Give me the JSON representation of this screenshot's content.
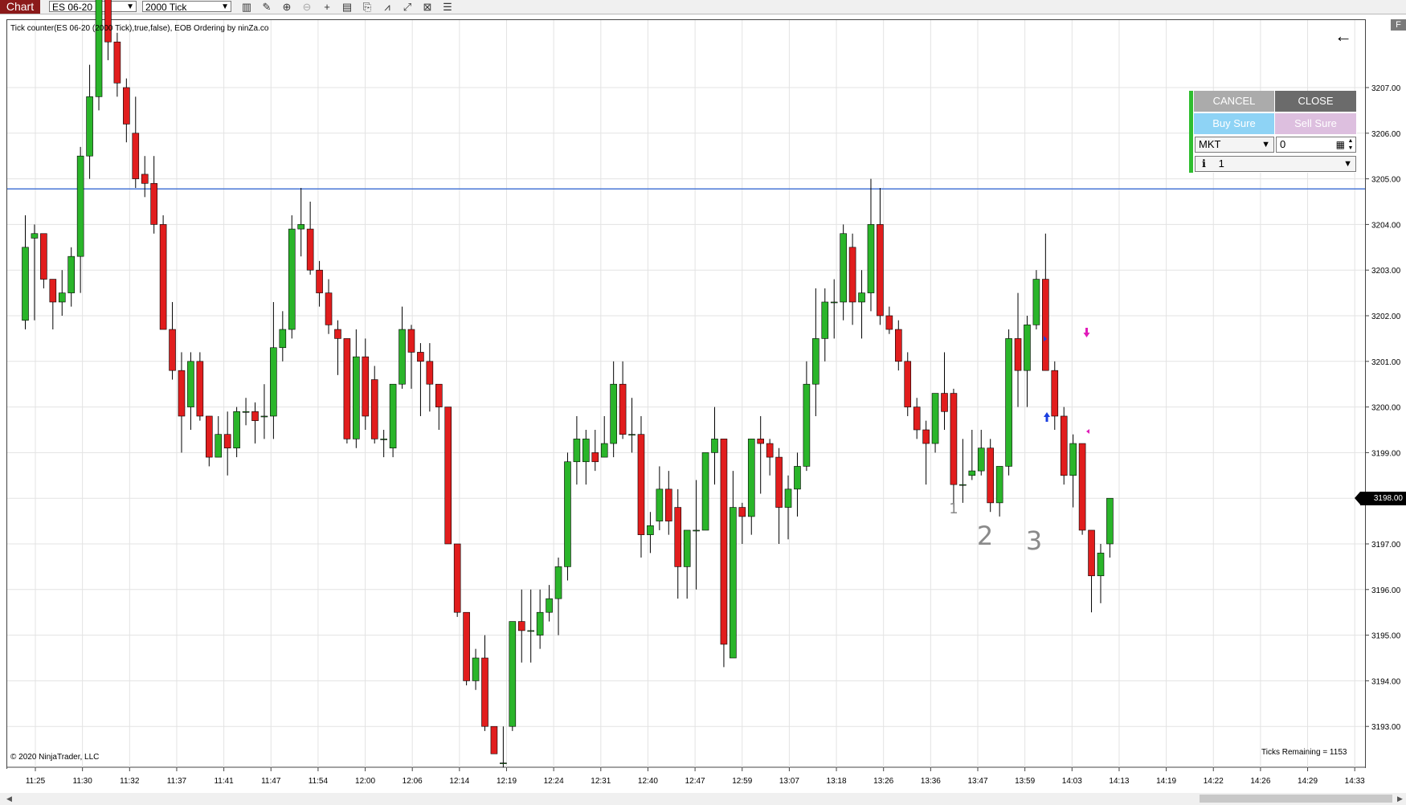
{
  "toolbar": {
    "chart_tab": "Chart",
    "instrument": "ES 06-20",
    "interval": "2000 Tick",
    "icons": [
      "bar-type-icon",
      "draw-pencil-icon",
      "zoom-in-icon",
      "zoom-out-icon",
      "crosshair-icon",
      "properties-icon",
      "strategy-icon",
      "indicator-icon",
      "chart-trader-icon",
      "data-box-icon"
    ]
  },
  "chart": {
    "indicator_label": "Tick counter(ES 06-20 (2000 Tick),true,false), EOB Ordering by ninZa.co",
    "copyright": "© 2020 NinjaTrader, LLC",
    "ticks_remaining": "Ticks Remaining = 1153",
    "last_price": "3198.00",
    "price_levels": [
      "3207.00",
      "3206.00",
      "3205.00",
      "3204.00",
      "3203.00",
      "3202.00",
      "3201.00",
      "3200.00",
      "3199.00",
      "3198.00",
      "3197.00",
      "3196.00",
      "3195.00",
      "3194.00",
      "3193.00"
    ],
    "time_labels": [
      "11:25",
      "11:30",
      "11:32",
      "11:37",
      "11:41",
      "11:47",
      "11:54",
      "12:00",
      "12:06",
      "12:14",
      "12:19",
      "12:24",
      "12:31",
      "12:40",
      "12:47",
      "12:59",
      "13:07",
      "13:18",
      "13:26",
      "13:36",
      "13:47",
      "13:59",
      "14:03",
      "14:13",
      "14:19",
      "14:22",
      "14:26",
      "14:29",
      "14:33"
    ],
    "horizontal_line_price": 3204.78,
    "handwritten_annotations": [
      "1",
      "2",
      "3"
    ],
    "colors": {
      "up": "#2ab52a",
      "down": "#e11d1d",
      "line": "#4a78d6",
      "grid": "#e3e3e3"
    }
  },
  "chart_data": {
    "type": "candlestick",
    "y_axis_range": [
      3192.1,
      3208.9
    ],
    "bars": [
      {
        "o": 3201.9,
        "h": 3204.2,
        "l": 3201.7,
        "c": 3203.5
      },
      {
        "o": 3203.7,
        "h": 3204.0,
        "l": 3201.9,
        "c": 3203.8
      },
      {
        "o": 3203.8,
        "h": 3203.8,
        "l": 3202.6,
        "c": 3202.8
      },
      {
        "o": 3202.8,
        "h": 3202.8,
        "l": 3201.7,
        "c": 3202.3
      },
      {
        "o": 3202.3,
        "h": 3203.0,
        "l": 3202.0,
        "c": 3202.5
      },
      {
        "o": 3202.5,
        "h": 3203.5,
        "l": 3202.2,
        "c": 3203.3
      },
      {
        "o": 3203.3,
        "h": 3205.7,
        "l": 3202.5,
        "c": 3205.5
      },
      {
        "o": 3205.5,
        "h": 3207.5,
        "l": 3205.0,
        "c": 3206.8
      },
      {
        "o": 3206.8,
        "h": 3209.0,
        "l": 3206.5,
        "c": 3209.0
      },
      {
        "o": 3209.0,
        "h": 3209.0,
        "l": 3207.6,
        "c": 3208.0
      },
      {
        "o": 3208.0,
        "h": 3208.2,
        "l": 3206.8,
        "c": 3207.1
      },
      {
        "o": 3207.0,
        "h": 3207.2,
        "l": 3205.8,
        "c": 3206.2
      },
      {
        "o": 3206.0,
        "h": 3206.8,
        "l": 3204.8,
        "c": 3205.0
      },
      {
        "o": 3205.1,
        "h": 3205.5,
        "l": 3204.6,
        "c": 3204.9
      },
      {
        "o": 3204.9,
        "h": 3205.5,
        "l": 3203.8,
        "c": 3204.0
      },
      {
        "o": 3204.0,
        "h": 3204.2,
        "l": 3201.7,
        "c": 3201.7
      },
      {
        "o": 3201.7,
        "h": 3202.3,
        "l": 3200.6,
        "c": 3200.8
      },
      {
        "o": 3200.8,
        "h": 3201.2,
        "l": 3199.0,
        "c": 3199.8
      },
      {
        "o": 3200.0,
        "h": 3201.2,
        "l": 3199.5,
        "c": 3201.0
      },
      {
        "o": 3201.0,
        "h": 3201.2,
        "l": 3199.7,
        "c": 3199.8
      },
      {
        "o": 3199.8,
        "h": 3199.8,
        "l": 3198.7,
        "c": 3198.9
      },
      {
        "o": 3198.9,
        "h": 3199.8,
        "l": 3198.9,
        "c": 3199.4
      },
      {
        "o": 3199.4,
        "h": 3199.9,
        "l": 3198.5,
        "c": 3199.1
      },
      {
        "o": 3199.1,
        "h": 3200.0,
        "l": 3198.9,
        "c": 3199.9
      },
      {
        "o": 3199.9,
        "h": 3200.2,
        "l": 3199.6,
        "c": 3199.9
      },
      {
        "o": 3199.9,
        "h": 3200.1,
        "l": 3199.2,
        "c": 3199.7
      },
      {
        "o": 3199.8,
        "h": 3200.5,
        "l": 3199.3,
        "c": 3199.8
      },
      {
        "o": 3199.8,
        "h": 3202.3,
        "l": 3199.3,
        "c": 3201.3
      },
      {
        "o": 3201.3,
        "h": 3202.1,
        "l": 3201.0,
        "c": 3201.7
      },
      {
        "o": 3201.7,
        "h": 3204.2,
        "l": 3201.5,
        "c": 3203.9
      },
      {
        "o": 3203.9,
        "h": 3204.8,
        "l": 3203.3,
        "c": 3204.0
      },
      {
        "o": 3203.9,
        "h": 3204.5,
        "l": 3202.9,
        "c": 3203.0
      },
      {
        "o": 3203.0,
        "h": 3203.2,
        "l": 3202.2,
        "c": 3202.5
      },
      {
        "o": 3202.5,
        "h": 3202.8,
        "l": 3201.6,
        "c": 3201.8
      },
      {
        "o": 3201.7,
        "h": 3201.9,
        "l": 3200.7,
        "c": 3201.5
      },
      {
        "o": 3201.5,
        "h": 3201.5,
        "l": 3199.2,
        "c": 3199.3
      },
      {
        "o": 3199.3,
        "h": 3201.7,
        "l": 3199.1,
        "c": 3201.1
      },
      {
        "o": 3201.1,
        "h": 3201.5,
        "l": 3199.5,
        "c": 3199.8
      },
      {
        "o": 3200.6,
        "h": 3200.9,
        "l": 3199.2,
        "c": 3199.3
      },
      {
        "o": 3199.3,
        "h": 3199.5,
        "l": 3198.9,
        "c": 3199.3
      },
      {
        "o": 3199.1,
        "h": 3200.5,
        "l": 3198.9,
        "c": 3200.5
      },
      {
        "o": 3200.5,
        "h": 3202.2,
        "l": 3200.4,
        "c": 3201.7
      },
      {
        "o": 3201.7,
        "h": 3201.8,
        "l": 3200.4,
        "c": 3201.2
      },
      {
        "o": 3201.2,
        "h": 3201.4,
        "l": 3199.8,
        "c": 3201.0
      },
      {
        "o": 3201.0,
        "h": 3201.4,
        "l": 3199.9,
        "c": 3200.5
      },
      {
        "o": 3200.5,
        "h": 3200.5,
        "l": 3199.5,
        "c": 3200.0
      },
      {
        "o": 3200.0,
        "h": 3200.0,
        "l": 3197.0,
        "c": 3197.0
      },
      {
        "o": 3197.0,
        "h": 3197.0,
        "l": 3195.4,
        "c": 3195.5
      },
      {
        "o": 3195.5,
        "h": 3195.5,
        "l": 3193.9,
        "c": 3194.0
      },
      {
        "o": 3194.0,
        "h": 3194.7,
        "l": 3193.8,
        "c": 3194.5
      },
      {
        "o": 3194.5,
        "h": 3195.0,
        "l": 3192.9,
        "c": 3193.0
      },
      {
        "o": 3193.0,
        "h": 3193.0,
        "l": 3192.4,
        "c": 3192.4
      },
      {
        "o": 3192.2,
        "h": 3193.0,
        "l": 3192.1,
        "c": 3192.2
      },
      {
        "o": 3193.0,
        "h": 3195.2,
        "l": 3192.9,
        "c": 3195.3
      },
      {
        "o": 3195.3,
        "h": 3196.0,
        "l": 3194.4,
        "c": 3195.1
      },
      {
        "o": 3195.1,
        "h": 3196.0,
        "l": 3194.4,
        "c": 3195.1
      },
      {
        "o": 3195.0,
        "h": 3196.0,
        "l": 3194.7,
        "c": 3195.5
      },
      {
        "o": 3195.5,
        "h": 3196.1,
        "l": 3195.3,
        "c": 3195.8
      },
      {
        "o": 3195.8,
        "h": 3196.7,
        "l": 3195.0,
        "c": 3196.5
      },
      {
        "o": 3196.5,
        "h": 3199.0,
        "l": 3196.2,
        "c": 3198.8
      },
      {
        "o": 3198.8,
        "h": 3199.8,
        "l": 3198.3,
        "c": 3199.3
      },
      {
        "o": 3198.8,
        "h": 3199.5,
        "l": 3198.3,
        "c": 3199.3
      },
      {
        "o": 3199.0,
        "h": 3199.5,
        "l": 3198.6,
        "c": 3198.8
      },
      {
        "o": 3198.9,
        "h": 3199.8,
        "l": 3198.9,
        "c": 3199.2
      },
      {
        "o": 3199.2,
        "h": 3201.0,
        "l": 3198.9,
        "c": 3200.5
      },
      {
        "o": 3200.5,
        "h": 3201.0,
        "l": 3199.3,
        "c": 3199.4
      },
      {
        "o": 3199.4,
        "h": 3200.2,
        "l": 3199.0,
        "c": 3199.4
      },
      {
        "o": 3199.4,
        "h": 3199.8,
        "l": 3196.7,
        "c": 3197.2
      },
      {
        "o": 3197.2,
        "h": 3197.7,
        "l": 3196.8,
        "c": 3197.4
      },
      {
        "o": 3197.5,
        "h": 3198.7,
        "l": 3197.3,
        "c": 3198.2
      },
      {
        "o": 3198.2,
        "h": 3198.6,
        "l": 3197.2,
        "c": 3197.5
      },
      {
        "o": 3197.8,
        "h": 3198.2,
        "l": 3195.8,
        "c": 3196.5
      },
      {
        "o": 3196.5,
        "h": 3197.3,
        "l": 3195.8,
        "c": 3197.3
      },
      {
        "o": 3197.3,
        "h": 3198.4,
        "l": 3196.0,
        "c": 3197.3
      },
      {
        "o": 3197.3,
        "h": 3199.0,
        "l": 3197.3,
        "c": 3199.0
      },
      {
        "o": 3199.0,
        "h": 3200.0,
        "l": 3198.3,
        "c": 3199.3
      },
      {
        "o": 3199.3,
        "h": 3199.3,
        "l": 3194.3,
        "c": 3194.8
      },
      {
        "o": 3194.5,
        "h": 3198.6,
        "l": 3194.5,
        "c": 3197.8
      },
      {
        "o": 3197.8,
        "h": 3197.9,
        "l": 3197.0,
        "c": 3197.6
      },
      {
        "o": 3197.6,
        "h": 3199.3,
        "l": 3197.2,
        "c": 3199.3
      },
      {
        "o": 3199.3,
        "h": 3199.8,
        "l": 3198.1,
        "c": 3199.2
      },
      {
        "o": 3199.2,
        "h": 3199.3,
        "l": 3198.5,
        "c": 3198.9
      },
      {
        "o": 3198.9,
        "h": 3199.1,
        "l": 3197.0,
        "c": 3197.8
      },
      {
        "o": 3197.8,
        "h": 3198.5,
        "l": 3197.1,
        "c": 3198.2
      },
      {
        "o": 3198.2,
        "h": 3199.0,
        "l": 3197.6,
        "c": 3198.7
      },
      {
        "o": 3198.7,
        "h": 3201.0,
        "l": 3198.6,
        "c": 3200.5
      },
      {
        "o": 3200.5,
        "h": 3202.6,
        "l": 3199.8,
        "c": 3201.5
      },
      {
        "o": 3201.5,
        "h": 3202.6,
        "l": 3201.0,
        "c": 3202.3
      },
      {
        "o": 3202.3,
        "h": 3202.8,
        "l": 3201.5,
        "c": 3202.3
      },
      {
        "o": 3202.3,
        "h": 3204.0,
        "l": 3201.9,
        "c": 3203.8
      },
      {
        "o": 3203.5,
        "h": 3203.8,
        "l": 3201.8,
        "c": 3202.3
      },
      {
        "o": 3202.3,
        "h": 3203.0,
        "l": 3201.5,
        "c": 3202.5
      },
      {
        "o": 3202.5,
        "h": 3205.0,
        "l": 3202.1,
        "c": 3204.0
      },
      {
        "o": 3204.0,
        "h": 3204.8,
        "l": 3201.8,
        "c": 3202.0
      },
      {
        "o": 3202.0,
        "h": 3202.2,
        "l": 3201.6,
        "c": 3201.7
      },
      {
        "o": 3201.7,
        "h": 3201.9,
        "l": 3200.8,
        "c": 3201.0
      },
      {
        "o": 3201.0,
        "h": 3201.2,
        "l": 3199.8,
        "c": 3200.0
      },
      {
        "o": 3200.0,
        "h": 3200.2,
        "l": 3199.3,
        "c": 3199.5
      },
      {
        "o": 3199.5,
        "h": 3199.7,
        "l": 3198.3,
        "c": 3199.2
      },
      {
        "o": 3199.2,
        "h": 3200.2,
        "l": 3199.0,
        "c": 3200.3
      },
      {
        "o": 3200.3,
        "h": 3201.2,
        "l": 3199.5,
        "c": 3199.9
      },
      {
        "o": 3200.3,
        "h": 3200.4,
        "l": 3197.8,
        "c": 3198.3
      },
      {
        "o": 3198.3,
        "h": 3199.3,
        "l": 3197.9,
        "c": 3198.3
      },
      {
        "o": 3198.5,
        "h": 3199.5,
        "l": 3198.4,
        "c": 3198.6
      },
      {
        "o": 3198.6,
        "h": 3199.5,
        "l": 3198.5,
        "c": 3199.1
      },
      {
        "o": 3199.1,
        "h": 3199.3,
        "l": 3197.7,
        "c": 3197.9
      },
      {
        "o": 3197.9,
        "h": 3198.7,
        "l": 3197.6,
        "c": 3198.7
      },
      {
        "o": 3198.7,
        "h": 3201.7,
        "l": 3198.5,
        "c": 3201.5
      },
      {
        "o": 3201.5,
        "h": 3202.5,
        "l": 3200.0,
        "c": 3200.8
      },
      {
        "o": 3200.8,
        "h": 3202.0,
        "l": 3200.0,
        "c": 3201.8
      },
      {
        "o": 3201.8,
        "h": 3203.0,
        "l": 3201.7,
        "c": 3202.8
      },
      {
        "o": 3202.8,
        "h": 3203.8,
        "l": 3200.8,
        "c": 3200.8
      },
      {
        "o": 3200.8,
        "h": 3201.0,
        "l": 3199.5,
        "c": 3199.8
      },
      {
        "o": 3199.8,
        "h": 3200.0,
        "l": 3198.3,
        "c": 3198.5
      },
      {
        "o": 3198.5,
        "h": 3199.4,
        "l": 3197.8,
        "c": 3199.2
      },
      {
        "o": 3199.2,
        "h": 3199.2,
        "l": 3197.2,
        "c": 3197.3
      },
      {
        "o": 3197.3,
        "h": 3197.3,
        "l": 3195.5,
        "c": 3196.3
      },
      {
        "o": 3196.3,
        "h": 3197.0,
        "l": 3195.7,
        "c": 3196.8
      },
      {
        "o": 3197.0,
        "h": 3198.0,
        "l": 3196.7,
        "c": 3198.0
      }
    ]
  },
  "order_panel": {
    "cancel_label": "CANCEL",
    "close_label": "CLOSE",
    "buy_label": "Buy Sure",
    "sell_label": "Sell Sure",
    "order_type": "MKT",
    "quantity": "0",
    "account_icon": "ℹ",
    "account_value": "1"
  },
  "icons": {
    "back": "left-arrow-icon",
    "float": "F"
  }
}
